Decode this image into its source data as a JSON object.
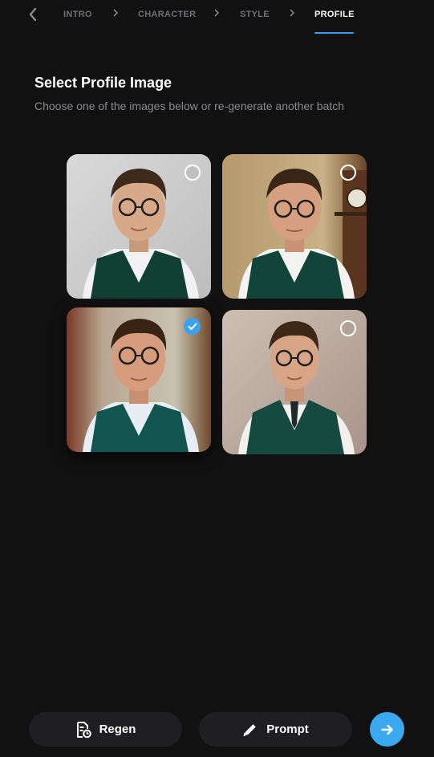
{
  "nav": {
    "back_icon": "chevron-left-icon",
    "steps": [
      {
        "label": "INTRO",
        "active": false
      },
      {
        "label": "CHARACTER",
        "active": false
      },
      {
        "label": "STYLE",
        "active": false
      },
      {
        "label": "PROFILE",
        "active": true
      }
    ],
    "accent_color": "#3b9df1"
  },
  "header": {
    "title": "Select Profile Image",
    "subtitle": "Choose one of the images below or re-generate another batch"
  },
  "images": [
    {
      "selected": false
    },
    {
      "selected": false
    },
    {
      "selected": true
    },
    {
      "selected": false
    }
  ],
  "footer": {
    "regen_label": "Regen",
    "regen_icon": "file-refresh-icon",
    "prompt_label": "Prompt",
    "prompt_icon": "pencil-icon",
    "next_icon": "arrow-right-icon",
    "next_color": "#3aa9f0"
  }
}
